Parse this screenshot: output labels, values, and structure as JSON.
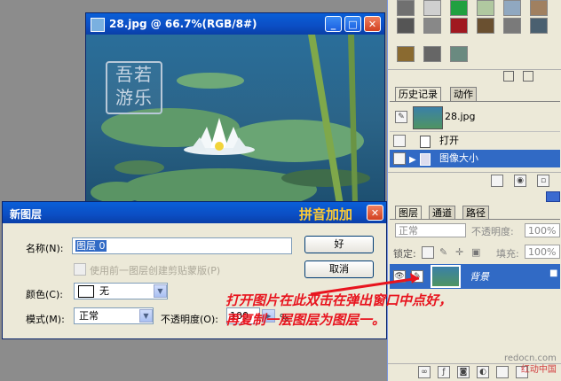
{
  "doc_window": {
    "title": "28.jpg @ 66.7%(RGB/8#)",
    "stamp_text": "吾若游乐"
  },
  "history": {
    "tabs": [
      "历史记录",
      "动作"
    ],
    "snapshot_label": "28.jpg",
    "items": [
      "打开",
      "图像大小"
    ]
  },
  "layers": {
    "tabs": [
      "图层",
      "通道",
      "路径"
    ],
    "blend_mode": "正常",
    "opacity_label": "不透明度:",
    "opacity_value": "100%",
    "lock_label": "锁定:",
    "fill_label": "填充:",
    "fill_value": "100%",
    "layer_name": "背景"
  },
  "dialog": {
    "title": "新图层",
    "brand": "拼音加加",
    "name_label": "名称(N):",
    "name_value": "图层 0",
    "clip_label": "使用前一图层创建剪贴蒙版(P)",
    "color_label": "颜色(C):",
    "color_value": "无",
    "mode_label": "模式(M):",
    "mode_value": "正常",
    "opacity_label": "不透明度(O):",
    "opacity_value": "100",
    "opacity_unit": "%",
    "ok_label": "好",
    "cancel_label": "取消"
  },
  "annotation": {
    "line1": "打开图片在此双击在弹出窗口中点好，",
    "line2": "再复制一层图层为图层一。"
  },
  "watermark": {
    "url": "redocn.com",
    "name": "红动中国"
  },
  "colors": {
    "titlebar": "#0b4ec4",
    "annotation": "#e8141e",
    "selected_row": "#316ac5"
  }
}
